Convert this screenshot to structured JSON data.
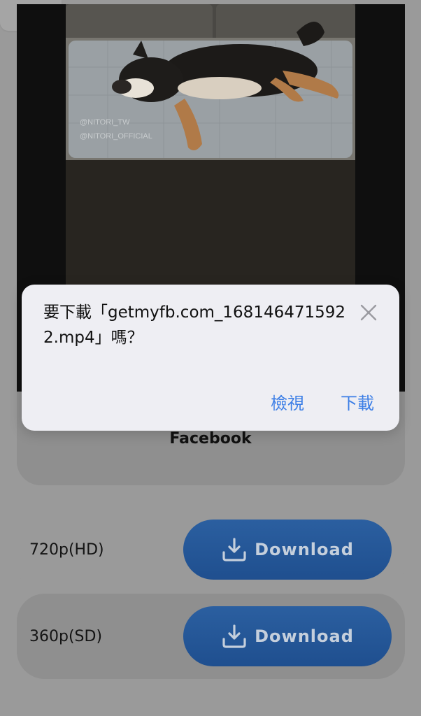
{
  "header": {
    "collapse_icon": "chevron-down-icon"
  },
  "video": {
    "watermark_line1": "@NITORI_TW",
    "watermark_line2": "@NITORI_OFFICIAL"
  },
  "source": {
    "name": "Facebook"
  },
  "qualities": [
    {
      "label": "720p(HD)",
      "button_label": "Download",
      "icon": "download-icon"
    },
    {
      "label": "360p(SD)",
      "button_label": "Download",
      "icon": "download-icon"
    }
  ],
  "dialog": {
    "message": "要下載「getmyfb.com_1681464715922.mp4」嗎？",
    "view_label": "檢視",
    "download_label": "下載",
    "close_icon": "close-icon"
  },
  "colors": {
    "button_blue": "#2b5fa0",
    "dialog_action": "#3d7fe6",
    "dialog_bg": "#eeeef3",
    "overlay_gray": "#9a9a9a"
  }
}
